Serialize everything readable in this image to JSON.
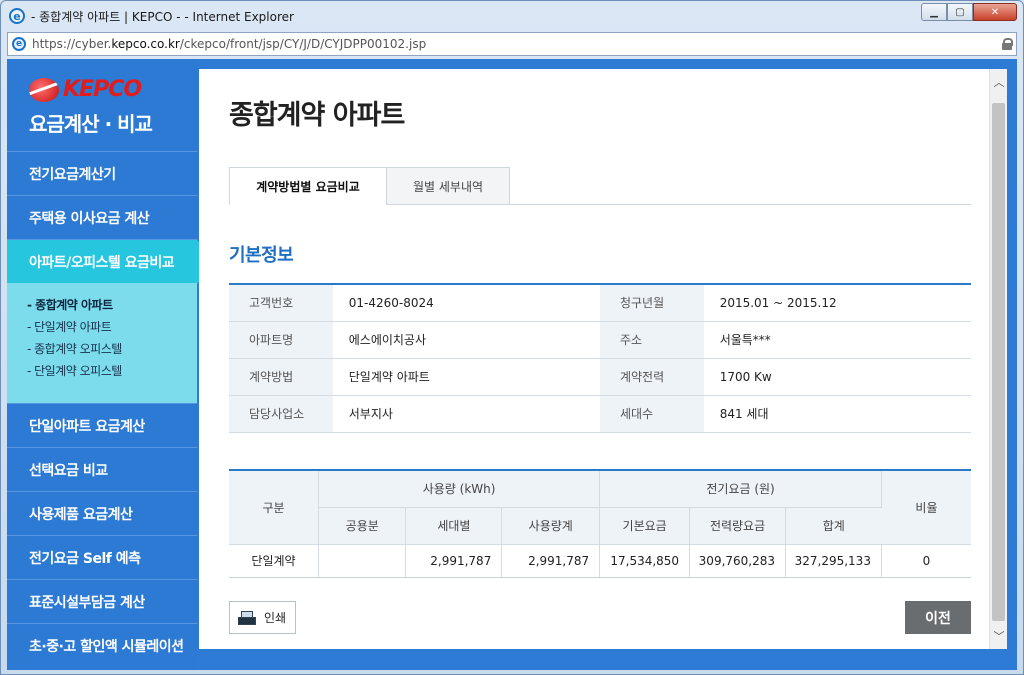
{
  "window": {
    "title": "- 종합계약 아파트 | KEPCO - - Internet Explorer",
    "url_prefix": "https://cyber.",
    "url_domain": "kepco.co.kr",
    "url_path": "/ckepco/front/jsp/CY/J/D/CYJDPP00102.jsp"
  },
  "logo": {
    "word": "KEPCO",
    "subtitle": "요금계산 · 비교"
  },
  "sidebar": {
    "items_top": [
      {
        "label": "전기요금계산기"
      },
      {
        "label": "주택용 이사요금 계산"
      },
      {
        "label": "아파트/오피스텔 요금비교"
      }
    ],
    "submenu": [
      {
        "label": "- 종합계약 아파트"
      },
      {
        "label": "- 단일계약 아파트"
      },
      {
        "label": "- 종합계약 오피스텔"
      },
      {
        "label": "- 단일계약 오피스텔"
      }
    ],
    "items_bottom": [
      {
        "label": "단일아파트 요금계산"
      },
      {
        "label": "선택요금 비교"
      },
      {
        "label": "사용제품 요금계산"
      },
      {
        "label": "전기요금 Self 예측"
      },
      {
        "label": "표준시설부담금 계산"
      },
      {
        "label": "초·중·고 할인액 시뮬레이션"
      }
    ]
  },
  "main": {
    "title": "종합계약 아파트",
    "tabs": [
      {
        "label": "계약방법별 요금비교"
      },
      {
        "label": "월별 세부내역"
      }
    ],
    "section_title": "기본정보",
    "info": [
      {
        "label1": "고객번호",
        "value1": "01-4260-8024",
        "label2": "청구년월",
        "value2": "2015.01 ~ 2015.12"
      },
      {
        "label1": "아파트명",
        "value1": "에스에이치공사",
        "label2": "주소",
        "value2": "서울특***"
      },
      {
        "label1": "계약방법",
        "value1": "단일계약 아파트",
        "label2": "계약전력",
        "value2": "1700 Kw"
      },
      {
        "label1": "담당사업소",
        "value1": "서부지사",
        "label2": "세대수",
        "value2": "841 세대"
      }
    ],
    "usage_table": {
      "headers": {
        "category": "구분",
        "usage_group": "사용량 (kWh)",
        "fee_group": "전기요금 (원)",
        "ratio": "비율",
        "common": "공용분",
        "household": "세대별",
        "usage_total": "사용량계",
        "base_fee": "기본요금",
        "energy_fee": "전력량요금",
        "sum": "합계"
      },
      "rows": [
        {
          "category": "단일계약",
          "common": "",
          "household": "2,991,787",
          "usage_total": "2,991,787",
          "base_fee": "17,534,850",
          "energy_fee": "309,760,283",
          "sum": "327,295,133",
          "ratio": "0"
        }
      ]
    },
    "print_label": "인쇄",
    "prev_label": "이전"
  },
  "colors": {
    "sidebar_bg": "#2d7ad5",
    "active_menu": "#26c6df",
    "submenu_bg": "#7ddcec",
    "accent_blue": "#1f6ec3",
    "prev_button": "#6a6d70"
  }
}
